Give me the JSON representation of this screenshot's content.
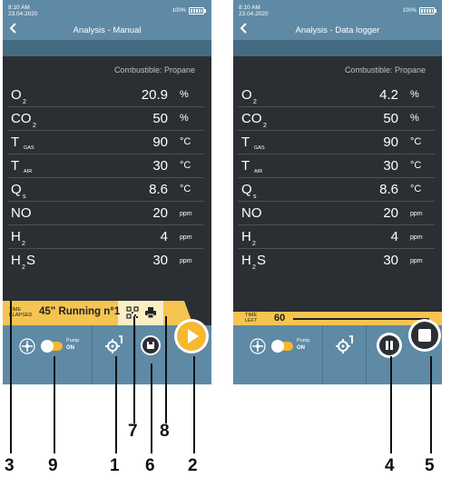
{
  "left_screen": {
    "status": {
      "time": "8:10 AM",
      "date": "23.04.2020",
      "battery": "100%"
    },
    "title": "Analysis - Manual",
    "combustible": "Combustible: Propane",
    "rows": [
      {
        "label": "O",
        "sub": "2",
        "value": "20.9",
        "unit": "%"
      },
      {
        "label": "CO",
        "sub": "2",
        "value": "50",
        "unit": "%"
      },
      {
        "label": "T",
        "sub": "GAS",
        "value": "90",
        "unit": "°C"
      },
      {
        "label": "T",
        "sub": "AIR",
        "value": "30",
        "unit": "°C"
      },
      {
        "label": "Q",
        "sub": "s",
        "value": "8.6",
        "unit": "°C"
      },
      {
        "label": "NO",
        "sub": "",
        "value": "20",
        "unit": "ppm"
      },
      {
        "label": "H",
        "sub": "2",
        "value": "4",
        "unit": "ppm"
      },
      {
        "label": "H",
        "sub": "2",
        "label_suffix": "S",
        "value": "30",
        "unit": "ppm"
      }
    ],
    "status_bar": {
      "time_label_1": "TIME",
      "time_label_2": "ELAPSED",
      "running": "45\" Running n°1"
    },
    "pump": {
      "label": "Pump",
      "state": "ON"
    }
  },
  "right_screen": {
    "status": {
      "time": "8:10 AM",
      "date": "23.04.2020",
      "battery": "100%"
    },
    "title": "Analysis - Data logger",
    "combustible": "Combustible: Propane",
    "rows": [
      {
        "label": "O",
        "sub": "2",
        "value": "4.2",
        "unit": "%"
      },
      {
        "label": "CO",
        "sub": "2",
        "value": "50",
        "unit": "%"
      },
      {
        "label": "T",
        "sub": "GAS",
        "value": "90",
        "unit": "°C"
      },
      {
        "label": "T",
        "sub": "AIR",
        "value": "30",
        "unit": "°C"
      },
      {
        "label": "Q",
        "sub": "s",
        "value": "8.6",
        "unit": "°C"
      },
      {
        "label": "NO",
        "sub": "",
        "value": "20",
        "unit": "ppm"
      },
      {
        "label": "H",
        "sub": "2",
        "value": "4",
        "unit": "ppm"
      },
      {
        "label": "H",
        "sub": "2",
        "label_suffix": "S",
        "value": "30",
        "unit": "ppm"
      }
    ],
    "time_left": {
      "label_1": "TIME",
      "label_2": "LEFT",
      "value": "60"
    },
    "pump": {
      "label": "Pump",
      "state": "ON"
    }
  },
  "callouts": [
    "3",
    "9",
    "1",
    "6",
    "2",
    "7",
    "8",
    "4",
    "5"
  ],
  "colors": {
    "header_blue": "#5e8aa6",
    "panel_dark": "#2b2f33",
    "accent_yellow": "#f5c451",
    "play_orange": "#f5b82e"
  }
}
